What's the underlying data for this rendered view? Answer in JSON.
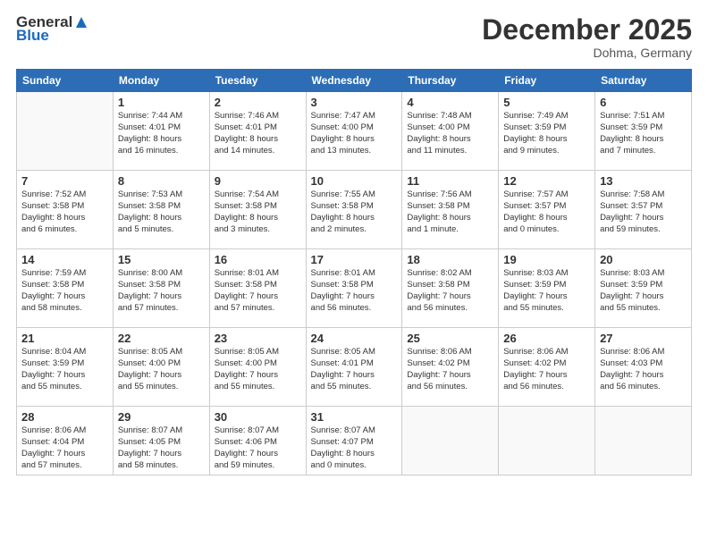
{
  "logo": {
    "general": "General",
    "blue": "Blue"
  },
  "title": {
    "month": "December 2025",
    "location": "Dohma, Germany"
  },
  "headers": [
    "Sunday",
    "Monday",
    "Tuesday",
    "Wednesday",
    "Thursday",
    "Friday",
    "Saturday"
  ],
  "weeks": [
    [
      {
        "day": "",
        "text": ""
      },
      {
        "day": "1",
        "text": "Sunrise: 7:44 AM\nSunset: 4:01 PM\nDaylight: 8 hours\nand 16 minutes."
      },
      {
        "day": "2",
        "text": "Sunrise: 7:46 AM\nSunset: 4:01 PM\nDaylight: 8 hours\nand 14 minutes."
      },
      {
        "day": "3",
        "text": "Sunrise: 7:47 AM\nSunset: 4:00 PM\nDaylight: 8 hours\nand 13 minutes."
      },
      {
        "day": "4",
        "text": "Sunrise: 7:48 AM\nSunset: 4:00 PM\nDaylight: 8 hours\nand 11 minutes."
      },
      {
        "day": "5",
        "text": "Sunrise: 7:49 AM\nSunset: 3:59 PM\nDaylight: 8 hours\nand 9 minutes."
      },
      {
        "day": "6",
        "text": "Sunrise: 7:51 AM\nSunset: 3:59 PM\nDaylight: 8 hours\nand 7 minutes."
      }
    ],
    [
      {
        "day": "7",
        "text": "Sunrise: 7:52 AM\nSunset: 3:58 PM\nDaylight: 8 hours\nand 6 minutes."
      },
      {
        "day": "8",
        "text": "Sunrise: 7:53 AM\nSunset: 3:58 PM\nDaylight: 8 hours\nand 5 minutes."
      },
      {
        "day": "9",
        "text": "Sunrise: 7:54 AM\nSunset: 3:58 PM\nDaylight: 8 hours\nand 3 minutes."
      },
      {
        "day": "10",
        "text": "Sunrise: 7:55 AM\nSunset: 3:58 PM\nDaylight: 8 hours\nand 2 minutes."
      },
      {
        "day": "11",
        "text": "Sunrise: 7:56 AM\nSunset: 3:58 PM\nDaylight: 8 hours\nand 1 minute."
      },
      {
        "day": "12",
        "text": "Sunrise: 7:57 AM\nSunset: 3:57 PM\nDaylight: 8 hours\nand 0 minutes."
      },
      {
        "day": "13",
        "text": "Sunrise: 7:58 AM\nSunset: 3:57 PM\nDaylight: 7 hours\nand 59 minutes."
      }
    ],
    [
      {
        "day": "14",
        "text": "Sunrise: 7:59 AM\nSunset: 3:58 PM\nDaylight: 7 hours\nand 58 minutes."
      },
      {
        "day": "15",
        "text": "Sunrise: 8:00 AM\nSunset: 3:58 PM\nDaylight: 7 hours\nand 57 minutes."
      },
      {
        "day": "16",
        "text": "Sunrise: 8:01 AM\nSunset: 3:58 PM\nDaylight: 7 hours\nand 57 minutes."
      },
      {
        "day": "17",
        "text": "Sunrise: 8:01 AM\nSunset: 3:58 PM\nDaylight: 7 hours\nand 56 minutes."
      },
      {
        "day": "18",
        "text": "Sunrise: 8:02 AM\nSunset: 3:58 PM\nDaylight: 7 hours\nand 56 minutes."
      },
      {
        "day": "19",
        "text": "Sunrise: 8:03 AM\nSunset: 3:59 PM\nDaylight: 7 hours\nand 55 minutes."
      },
      {
        "day": "20",
        "text": "Sunrise: 8:03 AM\nSunset: 3:59 PM\nDaylight: 7 hours\nand 55 minutes."
      }
    ],
    [
      {
        "day": "21",
        "text": "Sunrise: 8:04 AM\nSunset: 3:59 PM\nDaylight: 7 hours\nand 55 minutes."
      },
      {
        "day": "22",
        "text": "Sunrise: 8:05 AM\nSunset: 4:00 PM\nDaylight: 7 hours\nand 55 minutes."
      },
      {
        "day": "23",
        "text": "Sunrise: 8:05 AM\nSunset: 4:00 PM\nDaylight: 7 hours\nand 55 minutes."
      },
      {
        "day": "24",
        "text": "Sunrise: 8:05 AM\nSunset: 4:01 PM\nDaylight: 7 hours\nand 55 minutes."
      },
      {
        "day": "25",
        "text": "Sunrise: 8:06 AM\nSunset: 4:02 PM\nDaylight: 7 hours\nand 56 minutes."
      },
      {
        "day": "26",
        "text": "Sunrise: 8:06 AM\nSunset: 4:02 PM\nDaylight: 7 hours\nand 56 minutes."
      },
      {
        "day": "27",
        "text": "Sunrise: 8:06 AM\nSunset: 4:03 PM\nDaylight: 7 hours\nand 56 minutes."
      }
    ],
    [
      {
        "day": "28",
        "text": "Sunrise: 8:06 AM\nSunset: 4:04 PM\nDaylight: 7 hours\nand 57 minutes."
      },
      {
        "day": "29",
        "text": "Sunrise: 8:07 AM\nSunset: 4:05 PM\nDaylight: 7 hours\nand 58 minutes."
      },
      {
        "day": "30",
        "text": "Sunrise: 8:07 AM\nSunset: 4:06 PM\nDaylight: 7 hours\nand 59 minutes."
      },
      {
        "day": "31",
        "text": "Sunrise: 8:07 AM\nSunset: 4:07 PM\nDaylight: 8 hours\nand 0 minutes."
      },
      {
        "day": "",
        "text": ""
      },
      {
        "day": "",
        "text": ""
      },
      {
        "day": "",
        "text": ""
      }
    ]
  ]
}
